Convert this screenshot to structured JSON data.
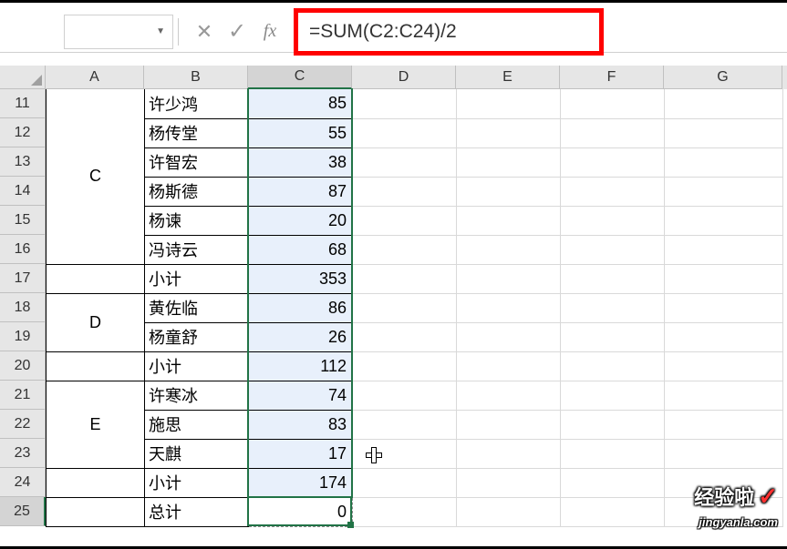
{
  "formula_bar": {
    "formula": "=SUM(C2:C24)/2",
    "fx_label": "fx"
  },
  "columns": [
    "A",
    "B",
    "C",
    "D",
    "E",
    "F",
    "G"
  ],
  "row_numbers": [
    "11",
    "12",
    "13",
    "14",
    "15",
    "16",
    "17",
    "18",
    "19",
    "20",
    "21",
    "22",
    "23",
    "24",
    "25"
  ],
  "groups": [
    {
      "label": "C",
      "rows": [
        {
          "name": "许少鸿",
          "value": 85
        },
        {
          "name": "杨传堂",
          "value": 55
        },
        {
          "name": "许智宏",
          "value": 38
        },
        {
          "name": "杨斯德",
          "value": 87
        },
        {
          "name": "杨谏",
          "value": 20
        },
        {
          "name": "冯诗云",
          "value": 68
        }
      ],
      "subtotal_label": "小计",
      "subtotal": 353
    },
    {
      "label": "D",
      "rows": [
        {
          "name": "黄佐临",
          "value": 86
        },
        {
          "name": "杨童舒",
          "value": 26
        }
      ],
      "subtotal_label": "小计",
      "subtotal": 112
    },
    {
      "label": "E",
      "rows": [
        {
          "name": "许寒冰",
          "value": 74
        },
        {
          "name": "施思",
          "value": 83
        },
        {
          "name": "天麒",
          "value": 17
        }
      ],
      "subtotal_label": "小计",
      "subtotal": 174
    }
  ],
  "total": {
    "label": "总计",
    "value": 0
  },
  "watermark": {
    "main": "经验啦",
    "check": "✓",
    "sub": "jingyanla.com"
  },
  "active_cell": "C25",
  "selected_column": "C"
}
